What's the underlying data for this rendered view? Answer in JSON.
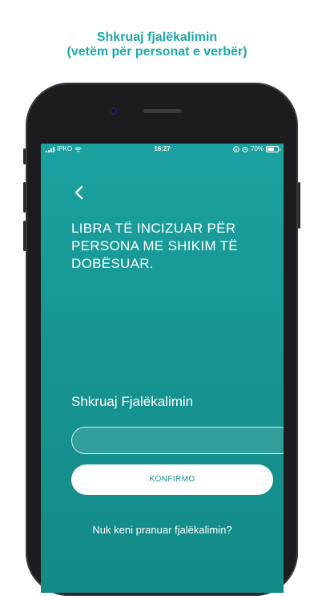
{
  "caption": {
    "line1": "Shkruaj fjalëkalimin",
    "line2": "(vetëm për personat e verbër)"
  },
  "status_bar": {
    "carrier": "IPKO",
    "time": "16:27",
    "battery": "70%",
    "battery_level": 0.7
  },
  "screen": {
    "headline": "LIBRA TË INCIZUAR PËR PERSONA ME SHIKIM TË DOBËSUAR.",
    "password_label": "Shkruaj Fjalëkalimin",
    "password_value": "",
    "confirm_label": "KONFIRMO",
    "forgot_link": "Nuk keni pranuar fjalëkalimin?"
  },
  "colors": {
    "accent": "#1aa9a6",
    "screen_bg": "#179694",
    "button_text": "#1a8f8d"
  }
}
